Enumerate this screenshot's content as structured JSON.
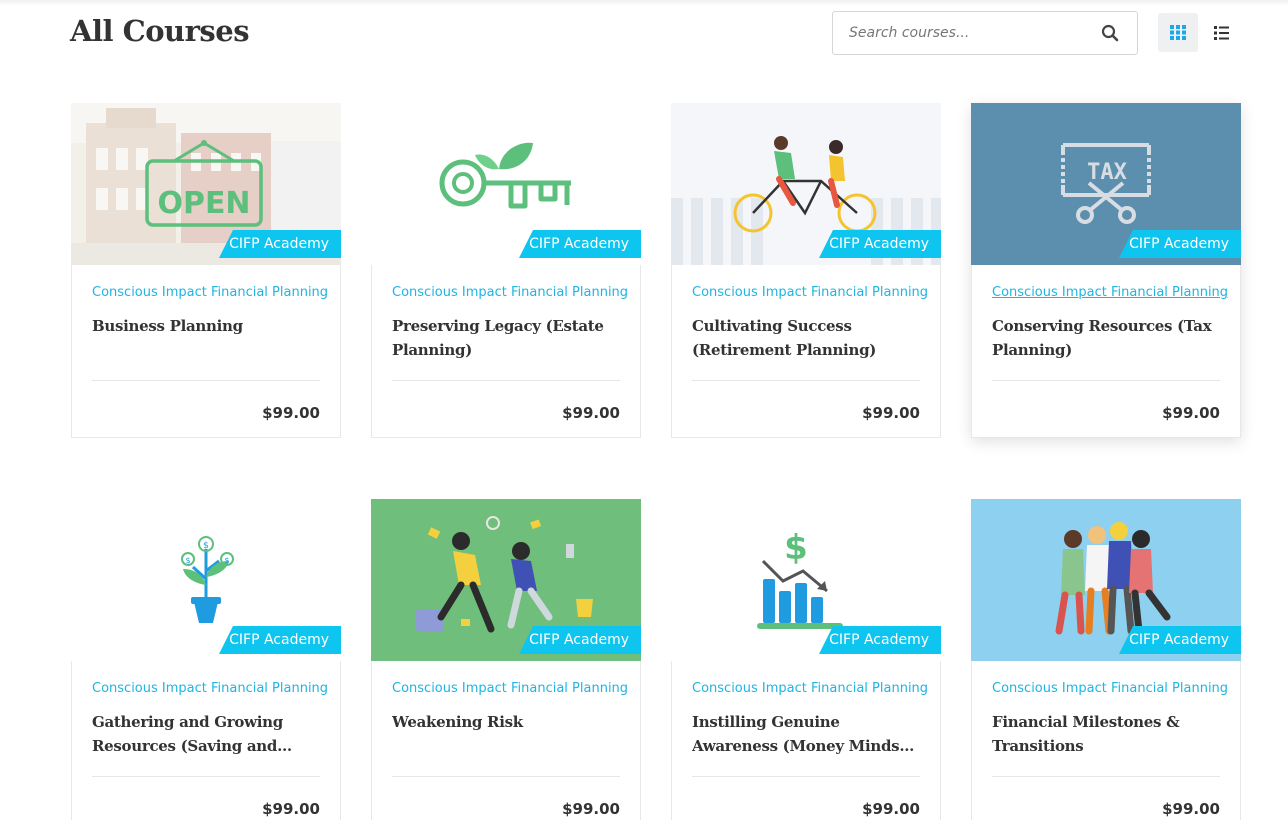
{
  "page": {
    "title": "All Courses"
  },
  "search": {
    "placeholder": "Search courses..."
  },
  "courses": [
    {
      "title": "Business Planning",
      "author": "Conscious Impact Financial Planning",
      "badge": "CIFP Academy",
      "price": "$99.00"
    },
    {
      "title": "Preserving Legacy (Estate Planning)",
      "author": "Conscious Impact Financial Planning",
      "badge": "CIFP Academy",
      "price": "$99.00"
    },
    {
      "title": "Cultivating Success (Retirement Planning)",
      "author": "Conscious Impact Financial Planning",
      "badge": "CIFP Academy",
      "price": "$99.00"
    },
    {
      "title": "Conserving Resources (Tax Planning)",
      "author": "Conscious Impact Financial Planning",
      "badge": "CIFP Academy",
      "price": "$99.00"
    },
    {
      "title": "Gathering and Growing Resources (Saving and…",
      "author": "Conscious Impact Financial Planning",
      "badge": "CIFP Academy",
      "price": "$99.00"
    },
    {
      "title": "Weakening Risk",
      "author": "Conscious Impact Financial Planning",
      "badge": "CIFP Academy",
      "price": "$99.00"
    },
    {
      "title": "Instilling Genuine Awareness (Money Mindset & Cash Flow)",
      "author": "Conscious Impact Financial Planning",
      "badge": "CIFP Academy",
      "price": "$99.00"
    },
    {
      "title": "Financial Milestones & Transitions",
      "author": "Conscious Impact Financial Planning",
      "badge": "CIFP Academy",
      "price": "$99.00"
    }
  ],
  "colors": {
    "accent": "#0ec5ef",
    "link": "#1fb4e3",
    "green": "#5cbf7c",
    "blue_icon": "#1f9be0"
  }
}
